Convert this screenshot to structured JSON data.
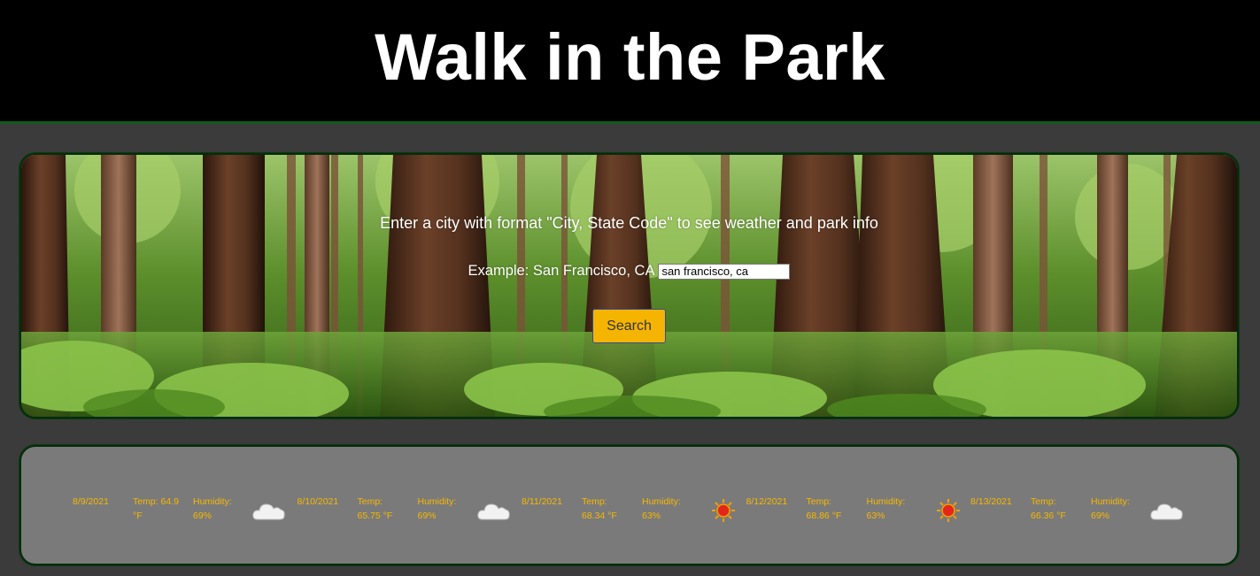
{
  "header": {
    "title": "Walk in the Park"
  },
  "search": {
    "prompt": "Enter a city with format \"City, State Code\" to see weather and park info",
    "example_label": "Example: San Francisco, CA",
    "input_value": "san francisco, ca",
    "button_label": "Search"
  },
  "forecast": [
    {
      "date": "8/9/2021",
      "temp_value": "Temp: 64.9",
      "temp_unit": "°F",
      "humidity_label": "Humidity:",
      "humidity_value": "69%",
      "icon": "cloud-icon"
    },
    {
      "date": "8/10/2021",
      "temp_value": "Temp:",
      "temp_unit": "65.75 °F",
      "humidity_label": "Humidity:",
      "humidity_value": "69%",
      "icon": "cloud-icon"
    },
    {
      "date": "8/11/2021",
      "temp_value": "Temp:",
      "temp_unit": "68.34 °F",
      "humidity_label": "Humidity:",
      "humidity_value": "63%",
      "icon": "sun-icon"
    },
    {
      "date": "8/12/2021",
      "temp_value": "Temp:",
      "temp_unit": "68.86 °F",
      "humidity_label": "Humidity:",
      "humidity_value": "63%",
      "icon": "sun-icon"
    },
    {
      "date": "8/13/2021",
      "temp_value": "Temp:",
      "temp_unit": "66.36 °F",
      "humidity_label": "Humidity:",
      "humidity_value": "69%",
      "icon": "cloud-icon"
    }
  ],
  "colors": {
    "header_bg": "#000000",
    "page_bg": "#3b3b3b",
    "accent_border": "#0e5a1c",
    "button_bg": "#f5b400",
    "forecast_text": "#f7b800",
    "forecast_panel_bg": "#7a7a7a"
  }
}
